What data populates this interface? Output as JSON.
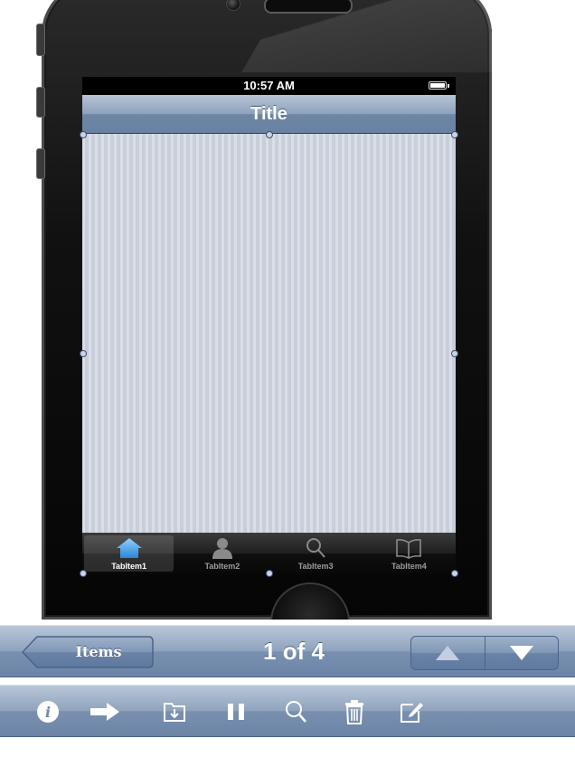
{
  "device": {
    "status_bar": {
      "time": "10:57 AM"
    }
  },
  "nav_bar": {
    "title": "Title"
  },
  "tab_bar": {
    "items": [
      {
        "label": "TabItem1",
        "icon": "home-icon",
        "selected": true
      },
      {
        "label": "TabItem2",
        "icon": "person-icon",
        "selected": false
      },
      {
        "label": "TabItem3",
        "icon": "search-icon",
        "selected": false
      },
      {
        "label": "TabItem4",
        "icon": "book-icon",
        "selected": false
      }
    ]
  },
  "navigation_toolbar": {
    "back_label": "Items",
    "page_indicator": "1 of 4",
    "segments": [
      "up-arrow-icon",
      "down-arrow-icon"
    ]
  },
  "action_toolbar": {
    "icons": [
      "info-icon",
      "forward-arrow-icon",
      "folder-download-icon",
      "pause-icon",
      "search-icon",
      "trash-icon",
      "compose-icon"
    ]
  },
  "colors": {
    "nav_bar": "#8ea2bc",
    "content_background": "#cdd3de",
    "tab_bar": "#1f1f1f",
    "selected_tab_icon": "#4aa3f0"
  }
}
